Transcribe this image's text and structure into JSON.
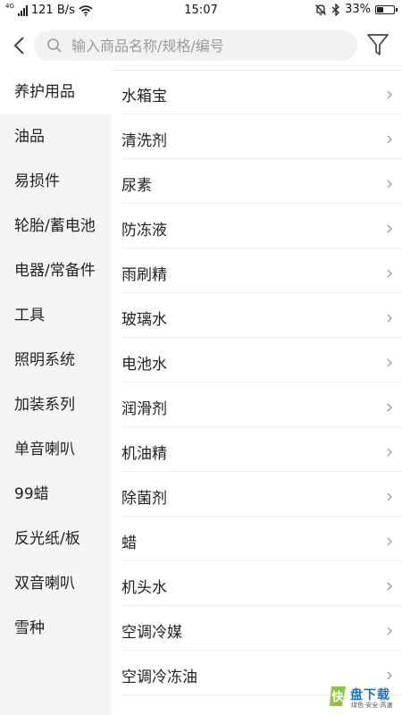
{
  "status": {
    "signal": "4G",
    "speed": "121 B/s",
    "time": "15:07",
    "battery": "33%",
    "battery_level": 0.33
  },
  "search": {
    "placeholder": "输入商品名称/规格/编号"
  },
  "sidebar": {
    "items": [
      {
        "label": "养护用品"
      },
      {
        "label": "油品"
      },
      {
        "label": "易损件"
      },
      {
        "label": "轮胎/蓄电池"
      },
      {
        "label": "电器/常备件"
      },
      {
        "label": "工具"
      },
      {
        "label": "照明系统"
      },
      {
        "label": "加装系列"
      },
      {
        "label": "单音喇叭"
      },
      {
        "label": "99蜡"
      },
      {
        "label": "反光纸/板"
      },
      {
        "label": "双音喇叭"
      },
      {
        "label": "雪种"
      }
    ]
  },
  "list": {
    "items": [
      {
        "label": "水箱宝"
      },
      {
        "label": "清洗剂"
      },
      {
        "label": "尿素"
      },
      {
        "label": "防冻液"
      },
      {
        "label": "雨刷精"
      },
      {
        "label": "玻璃水"
      },
      {
        "label": "电池水"
      },
      {
        "label": "润滑剂"
      },
      {
        "label": "机油精"
      },
      {
        "label": "除菌剂"
      },
      {
        "label": "蜡"
      },
      {
        "label": "机头水"
      },
      {
        "label": "空调冷媒"
      },
      {
        "label": "空调冷冻油"
      }
    ]
  },
  "watermark": {
    "logo_char": "快",
    "text": "盘下载",
    "sub": "绿色·安全·高速"
  },
  "colors": {
    "accent": "#1e73be",
    "logo_green": "#8cc63f",
    "sidebar_bg": "#f5f5f5"
  }
}
